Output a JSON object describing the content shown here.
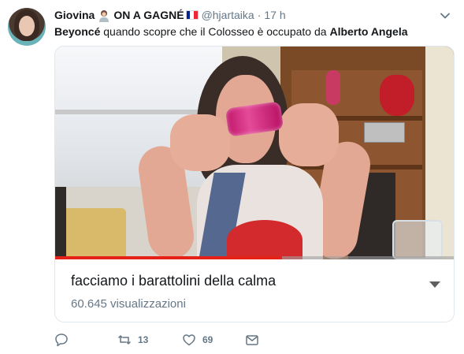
{
  "tweet": {
    "display_name": "Giovina",
    "display_name_suffix": "ON A GAGNÉ",
    "handle": "@hjartaika",
    "separator": "·",
    "time": "17 h",
    "text": {
      "part1_bold": "Beyoncé",
      "part2": " quando scopre che il Colosseo è occupato da ",
      "part3_bold": "Alberto Angela"
    }
  },
  "card": {
    "title": "facciamo i barattolini della calma",
    "views": "60.645 visualizzazioni",
    "progress_fraction": 0.57
  },
  "actions": {
    "reply_icon": "reply-icon",
    "retweet_count": "13",
    "like_count": "69",
    "dm_icon": "envelope-icon"
  },
  "colors": {
    "accent": "#1da1f2",
    "muted": "#657786",
    "progress": "#e62117",
    "flag": [
      "#002395",
      "#ffffff",
      "#ed2939"
    ]
  }
}
